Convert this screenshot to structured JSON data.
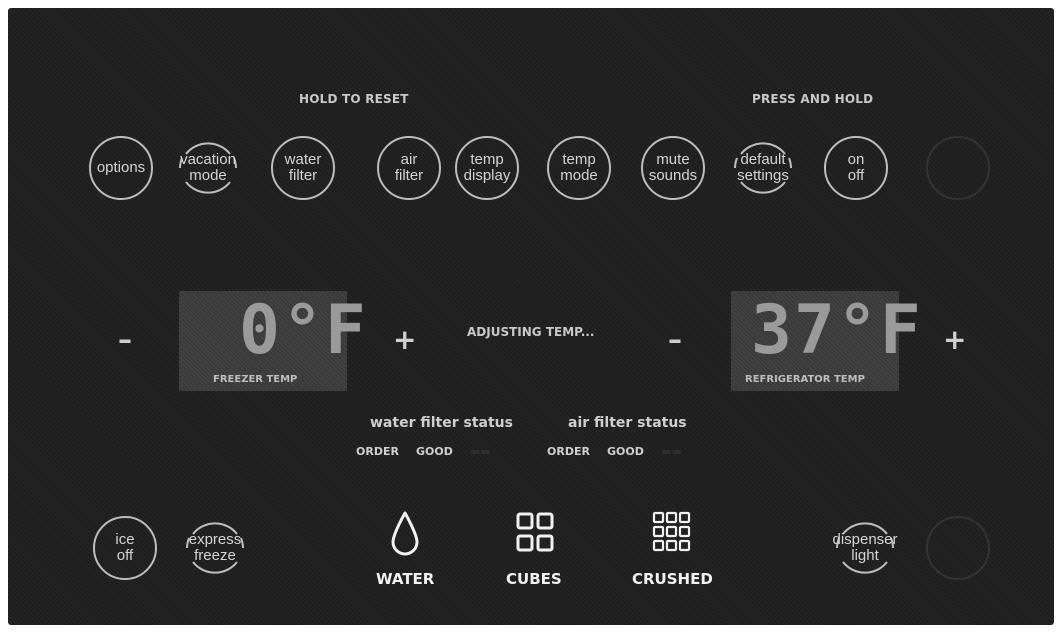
{
  "headers": {
    "hold_to_reset": "HOLD TO RESET",
    "press_and_hold": "PRESS AND HOLD"
  },
  "top_buttons": {
    "options": "options",
    "vacation_mode": "vacation\nmode",
    "water_filter": "water\nfilter",
    "air_filter": "air\nfilter",
    "temp_display": "temp\ndisplay",
    "temp_mode": "temp\nmode",
    "mute_sounds": "mute\nsounds",
    "default_settings": "default\nsettings",
    "on_off": "on\noff"
  },
  "freezer": {
    "minus": "–",
    "plus": "+",
    "temp": "0°F",
    "label": "FREEZER TEMP"
  },
  "refrigerator": {
    "minus": "–",
    "plus": "+",
    "temp": "37°F",
    "label": "REFRIGERATOR TEMP"
  },
  "center": {
    "message": "ADJUSTING TEMP..."
  },
  "filter_status": {
    "water_title": "water filter status",
    "air_title": "air filter status",
    "water_order": "ORDER",
    "water_good": "GOOD",
    "air_order": "ORDER",
    "air_good": "GOOD"
  },
  "bottom_buttons": {
    "ice_off": "ice\noff",
    "express_freeze": "express\nfreeze",
    "dispenser_light": "dispenser\nlight"
  },
  "dispense": {
    "water": "WATER",
    "cubes": "CUBES",
    "crushed": "CRUSHED"
  },
  "icons": {
    "water": "water-drop-icon",
    "cubes": "cubes-icon",
    "crushed": "crushed-ice-icon"
  },
  "colors": {
    "panel": "#1e1e1e",
    "ring": "#bdbdbd",
    "text": "#d4d4d4",
    "display_bg": "#3a3a3a"
  }
}
